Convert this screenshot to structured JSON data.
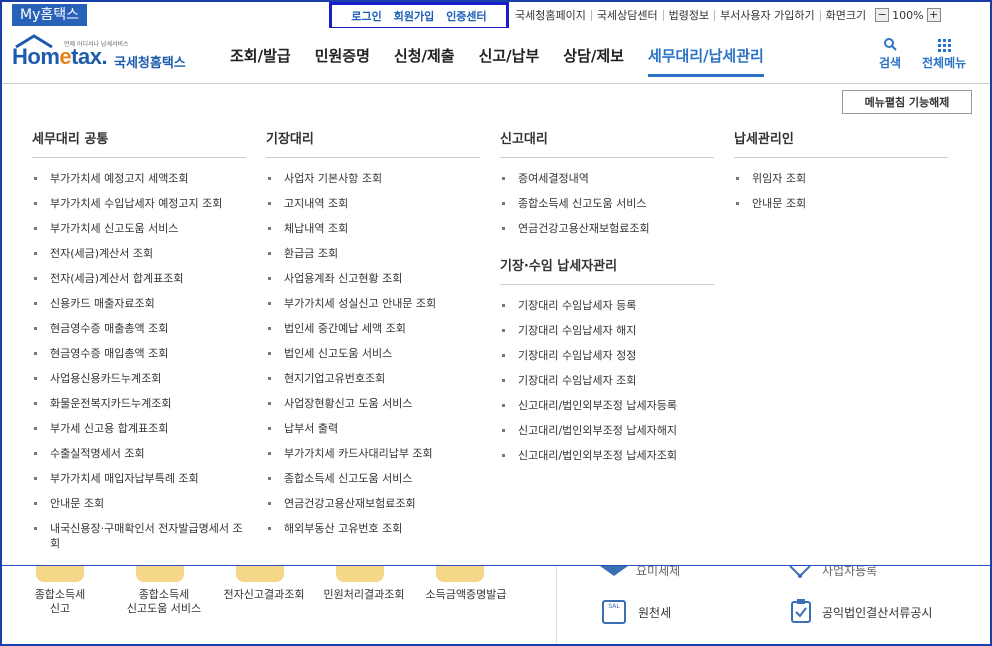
{
  "topbar": {
    "myhome": "My홈택스",
    "auth": [
      "로그인",
      "회원가입",
      "인증센터"
    ],
    "links": [
      "국세청홈페이지",
      "국세상담센터",
      "법령정보",
      "부서사용자 가입하기",
      "화면크기"
    ],
    "zoom_minus": "−",
    "zoom_value": "100%",
    "zoom_plus": "+"
  },
  "header": {
    "logo_small": "언제 어디서나 납세서비스",
    "logo_main_1": "Hom",
    "logo_main_e": "e",
    "logo_main_2": "tax.",
    "logo_sub": "국세청홈택스",
    "nav": [
      "조회/발급",
      "민원증명",
      "신청/제출",
      "신고/납부",
      "상담/제보",
      "세무대리/납세관리"
    ],
    "active_nav": "세무대리/납세관리",
    "search_label": "검색",
    "allmenu_label": "전체메뉴"
  },
  "menu": {
    "unfold_button": "메뉴펼침 기능해제",
    "col1": {
      "title": "세무대리 공통",
      "items": [
        "부가가치세 예정고지 세액조회",
        "부가가치세 수입납세자 예정고지 조회",
        "부가가치세 신고도움 서비스",
        "전자(세금)계산서 조회",
        "전자(세금)계산서 합계표조회",
        "신용카드 매출자료조회",
        "현금영수증 매출총액 조회",
        "현금영수증 매입총액 조회",
        "사업용신용카드누계조회",
        "화물운전복지카드누계조회",
        "부가세 신고용 합계표조회",
        "수출실적명세서 조회",
        "부가가치세 매입자납부특례 조회",
        "안내문 조회",
        "내국신용장·구매확인서 전자발급명세서 조회"
      ]
    },
    "col2": {
      "title": "기장대리",
      "items": [
        "사업자 기본사항 조회",
        "고지내역 조회",
        "체납내역 조회",
        "환급금 조회",
        "사업용계좌 신고현황 조회",
        "부가가치세 성실신고 안내문 조회",
        "법인세 중간예납 세액 조회",
        "법인세 신고도움 서비스",
        "현지기업고유번호조회",
        "사업장현황신고 도움 서비스",
        "납부서 출력",
        "부가가치세 카드사대리납부 조회",
        "종합소득세 신고도움 서비스",
        "연금건강고용산재보험료조회",
        "해외부동산 고유번호 조회"
      ]
    },
    "col3": {
      "title": "신고대리",
      "items": [
        "증여세결정내역",
        "종합소득세 신고도움 서비스",
        "연금건강고용산재보험료조회"
      ],
      "title2": "기장·수임 납세자관리",
      "items2": [
        "기장대리 수임납세자 등록",
        "기장대리 수임납세자 해지",
        "기장대리 수임납세자 정정",
        "기장대리 수임납세자 조회",
        "신고대리/법인외부조정 납세자등록",
        "신고대리/법인외부조정 납세자해지",
        "신고대리/법인외부조정 납세자조회"
      ]
    },
    "col4": {
      "title": "납세관리인",
      "items": [
        "위임자 조회",
        "안내문 조회"
      ]
    }
  },
  "bottom": {
    "left": [
      "종합소득세\n신고",
      "종합소득세\n신고도움 서비스",
      "전자신고결과조회",
      "민원처리결과조회",
      "소득금액증명발급"
    ],
    "right_top": [
      "요미세제",
      "사업자등록"
    ],
    "right_bottom": [
      "원천세",
      "공익법인결산서류공시"
    ],
    "sal_icon_text": "SAL"
  }
}
